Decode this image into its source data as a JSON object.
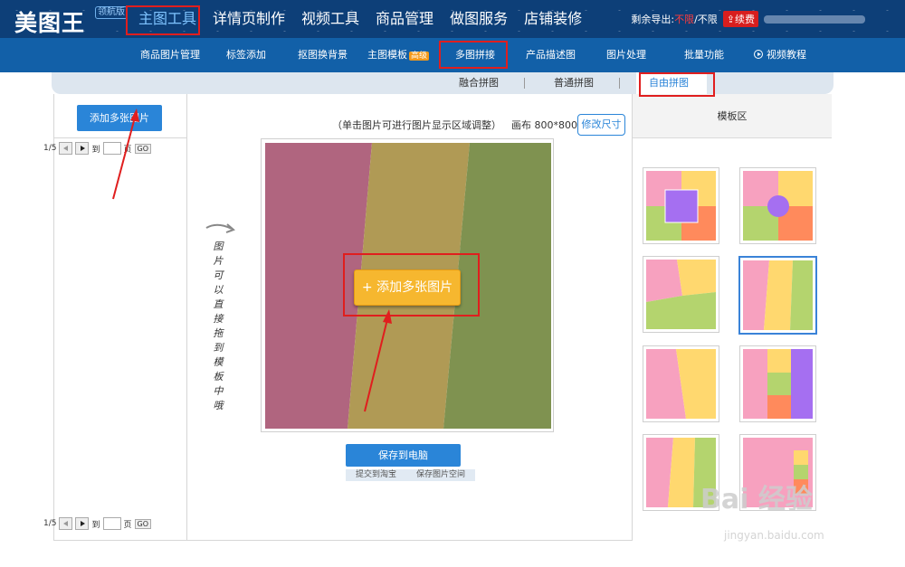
{
  "brand": {
    "logo": "美图王",
    "badge": "领航版"
  },
  "main_nav": [
    {
      "label": "主图工具",
      "active": true
    },
    {
      "label": "详情页制作"
    },
    {
      "label": "视频工具"
    },
    {
      "label": "商品管理"
    },
    {
      "label": "做图服务"
    },
    {
      "label": "店铺装修"
    }
  ],
  "account": {
    "remaining_label": "剩余导出:",
    "unlimited": "不限",
    "slash_unlimited": "/不限",
    "renew_label": "续费"
  },
  "sub_nav": [
    {
      "label": "商品图片管理"
    },
    {
      "label": "标签添加"
    },
    {
      "label": "抠图换背景"
    },
    {
      "label": "主图模板",
      "badge": "高级"
    },
    {
      "label": "多图拼接",
      "active": true
    },
    {
      "label": "产品描述图"
    },
    {
      "label": "图片处理"
    },
    {
      "label": "批量功能"
    },
    {
      "label": "视频教程",
      "icon": "play-circle-icon"
    }
  ],
  "tabs": [
    {
      "label": "融合拼图"
    },
    {
      "label": "普通拼图"
    },
    {
      "label": "自由拼图",
      "active": true
    }
  ],
  "left_panel": {
    "add_button": "添加多张图片"
  },
  "editor": {
    "hint": "（单击图片可进行图片显示区域调整）",
    "canvas_size": "画布 800*800",
    "resize_button": "修改尺寸",
    "add_multi_button": "+ 添加多张图片",
    "drag_hint": "图片可以直接拖到模板中哦",
    "save_button": "保存到电脑",
    "submit_taobao": "提交到淘宝",
    "save_space": "保存图片空间"
  },
  "template_panel": {
    "title": "模板区",
    "page": "1/5",
    "goto_label": "到",
    "page_unit": "页",
    "go_button": "GO"
  },
  "colors": {
    "topbar": "#0d3f78",
    "subnav": "#1260a8",
    "accent": "#2a85d8",
    "highlight": "#e01e1e",
    "canvas_pink": "#b0657f",
    "canvas_gold": "#b09a55",
    "canvas_green": "#7f9250",
    "tpl_pink": "#f7a1bf",
    "tpl_yellow": "#ffd86f",
    "tpl_orange": "#ff8a5c",
    "tpl_green": "#b4d46e",
    "tpl_purple": "#a56ff1"
  },
  "watermark": {
    "main": "Bai 经验",
    "sub": "jingyan.baidu.com"
  }
}
